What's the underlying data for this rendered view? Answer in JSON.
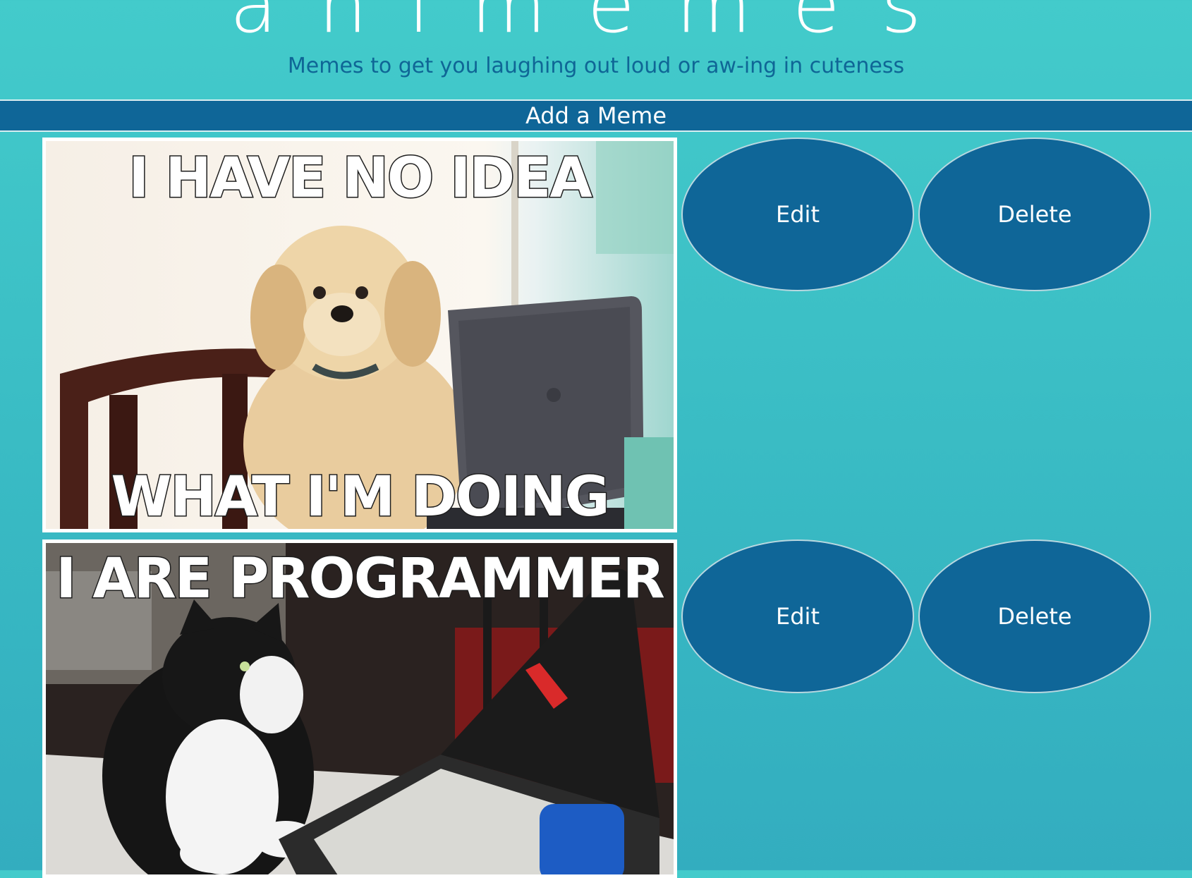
{
  "header": {
    "title": "animemes",
    "subtitle": "Memes to get you laughing out loud or aw-ing in cuteness"
  },
  "actions": {
    "add_label": "Add a Meme"
  },
  "memes": [
    {
      "top_text": "I HAVE NO IDEA",
      "bottom_text": "WHAT I'M DOING",
      "image_subject": "dog-at-laptop",
      "edit_label": "Edit",
      "delete_label": "Delete"
    },
    {
      "top_text": "I ARE PROGRAMMER",
      "image_subject": "cat-at-laptop",
      "edit_label": "Edit",
      "delete_label": "Delete"
    }
  ],
  "colors": {
    "background": "#3fc4c8",
    "accent": "#0f6698",
    "subtitle": "#0f6696",
    "button_text": "#ffffff"
  }
}
